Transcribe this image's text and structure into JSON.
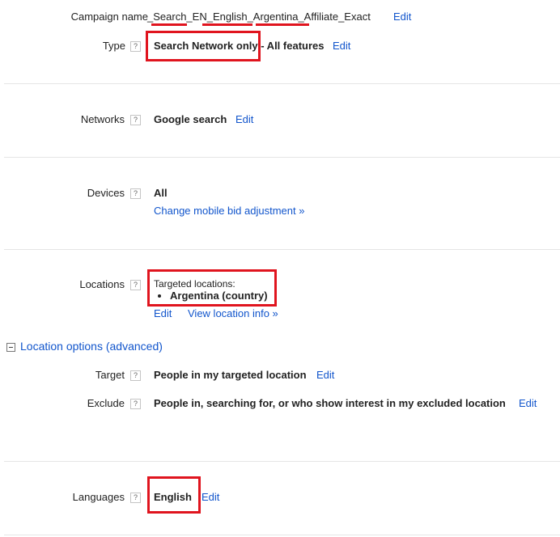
{
  "help_glyph": "?",
  "campaign_name": {
    "label": "Campaign name",
    "value": "_Search_EN_English_Argentina_Affiliate_Exact",
    "edit": "Edit"
  },
  "type": {
    "label": "Type",
    "value_main": "Search Network only",
    "value_rest": " - All features",
    "edit": "Edit"
  },
  "networks": {
    "label": "Networks",
    "value": "Google search",
    "edit": "Edit"
  },
  "devices": {
    "label": "Devices",
    "value": "All",
    "link": "Change mobile bid adjustment »"
  },
  "locations": {
    "label": "Locations",
    "targeted_label": "Targeted locations:",
    "items": [
      "Argentina (country)"
    ],
    "edit": "Edit",
    "view_info": "View location info »"
  },
  "location_options": {
    "title": "Location options (advanced)",
    "target": {
      "label": "Target",
      "value": "People in my targeted location",
      "edit": "Edit"
    },
    "exclude": {
      "label": "Exclude",
      "value": "People in, searching for, or who show interest in my excluded location",
      "edit": "Edit"
    }
  },
  "languages": {
    "label": "Languages",
    "value": "English",
    "edit": "Edit"
  },
  "colors": {
    "link": "#1155cc",
    "highlight": "#e0141e",
    "separator": "#e5e5e5"
  }
}
